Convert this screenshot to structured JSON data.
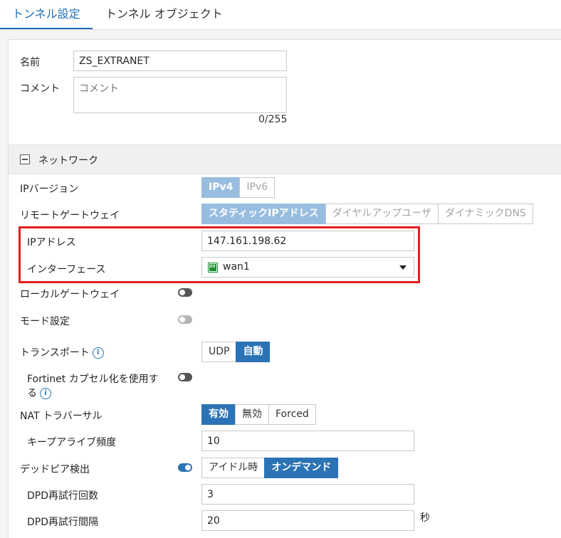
{
  "tabs": [
    "トンネル設定",
    "トンネル オブジェクト"
  ],
  "name": {
    "label": "名前",
    "value": "ZS_EXTRANET"
  },
  "comment": {
    "label": "コメント",
    "placeholder": "コメント",
    "counter": "0/255"
  },
  "network": {
    "section_title": "ネットワーク",
    "ip_version": {
      "label": "IPバージョン",
      "options": [
        "IPv4",
        "IPv6"
      ],
      "selected": "IPv4"
    },
    "remote_gateway": {
      "label": "リモートゲートウェイ",
      "options": [
        "スタティックIPアドレス",
        "ダイヤルアップユーザ",
        "ダイナミックDNS"
      ],
      "selected": "スタティックIPアドレス"
    },
    "ip_address": {
      "label": "IPアドレス",
      "value": "147.161.198.62"
    },
    "interface": {
      "label": "インターフェース",
      "value": "wan1",
      "icon": "network-port-icon",
      "icon_color": "#1a8f2e"
    },
    "local_gateway": {
      "label": "ローカルゲートウェイ",
      "enabled": false
    },
    "mode_config": {
      "label": "モード設定",
      "enabled": false,
      "disabled": true
    },
    "transport": {
      "label": "トランスポート",
      "info": "i",
      "options": [
        "UDP",
        "自動"
      ],
      "selected": "自動"
    },
    "fortinet_encap": {
      "label_line1": "Fortinet カプセル化を使用す",
      "label_line2": "る",
      "info": "i",
      "enabled": false
    },
    "nat_traversal": {
      "label": "NAT トラバーサル",
      "options": [
        "有効",
        "無効",
        "Forced"
      ],
      "selected": "有効"
    },
    "keepalive": {
      "label": "キープアライブ頻度",
      "value": "10"
    },
    "dead_peer": {
      "label": "デッドピア検出",
      "enabled": true,
      "options": [
        "アイドル時",
        "オンデマンド"
      ],
      "selected": "オンデマンド"
    },
    "dpd_retry_count": {
      "label": "DPD再試行回数",
      "value": "3"
    },
    "dpd_retry_interval": {
      "label": "DPD再試行間隔",
      "value": "20",
      "unit": "秒"
    }
  },
  "colors": {
    "accent": "#2b73b5",
    "highlight_box": "#e0201c",
    "accent_light": "#98bde0"
  }
}
